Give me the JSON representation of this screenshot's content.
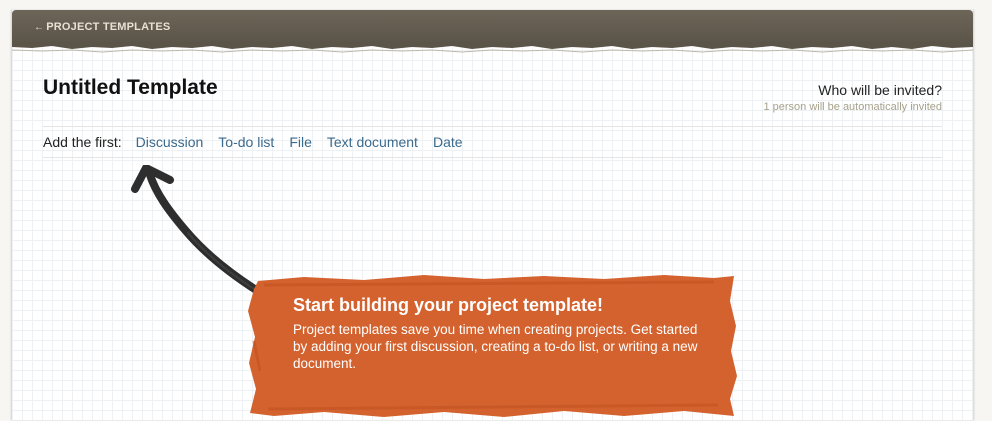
{
  "nav": {
    "back_arrow": "←",
    "back_label": "PROJECT TEMPLATES"
  },
  "page": {
    "title": "Untitled Template"
  },
  "invite": {
    "question": "Who will be invited?",
    "note": "1 person will be automatically invited"
  },
  "add_bar": {
    "label": "Add the first:",
    "items": [
      "Discussion",
      "To-do list",
      "File",
      "Text document",
      "Date"
    ]
  },
  "callout": {
    "heading": "Start building your project template!",
    "body": "Project templates save you time when creating projects. Get started by adding your first discussion, creating a to-do list, or writing a new document."
  },
  "colors": {
    "top_bar": "#5f584c",
    "link": "#3a6a8d",
    "callout": "#d4622e",
    "note": "#a7a28c"
  }
}
